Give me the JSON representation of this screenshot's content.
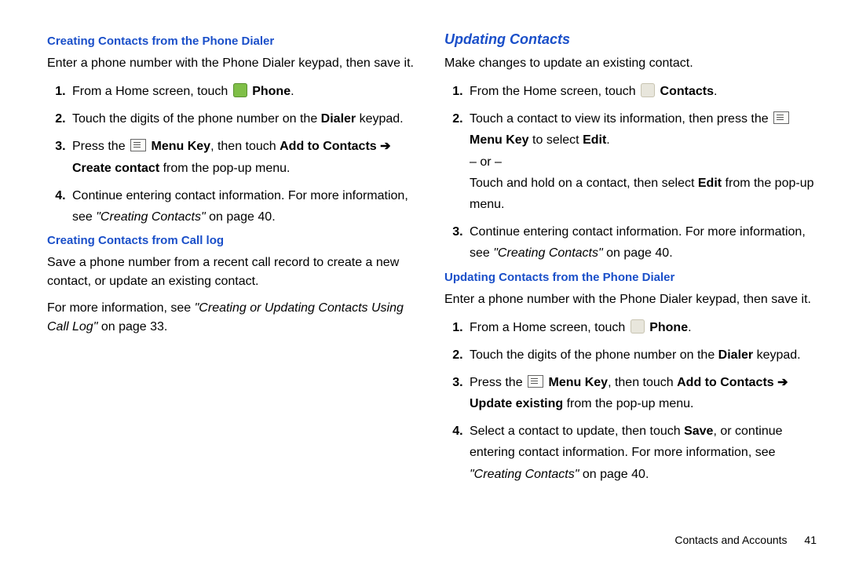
{
  "left": {
    "h1": "Creating Contacts from the Phone Dialer",
    "intro1": "Enter a phone number with the Phone Dialer keypad, then save it.",
    "s1_a": "From a Home screen, touch ",
    "s1_b": "Phone",
    "s1_c": ".",
    "s2_a": "Touch the digits of the phone number on the ",
    "s2_b": "Dialer",
    "s2_c": " keypad.",
    "s3_a": "Press the ",
    "s3_b": "Menu Key",
    "s3_c": ", then touch ",
    "s3_d": "Add to Contacts",
    "s3_e": " ➔ ",
    "s3_f": "Create contact",
    "s3_g": " from the pop-up menu.",
    "s4_a": "Continue entering contact information. For more information, see ",
    "s4_b": "\"Creating Contacts\"",
    "s4_c": " on page 40.",
    "h2": "Creating Contacts from Call log",
    "intro2": "Save a phone number from a recent call record to create a new contact, or update an existing contact.",
    "intro3_a": "For more information, see ",
    "intro3_b": "\"Creating or Updating Contacts Using Call Log\"",
    "intro3_c": " on page 33."
  },
  "right": {
    "sect": "Updating Contacts",
    "intro1": "Make changes to update an existing contact.",
    "s1_a": "From the Home screen, touch ",
    "s1_b": "Contacts",
    "s1_c": ".",
    "s2_a": "Touch a contact to view its information, then press the ",
    "s2_b": "Menu Key",
    "s2_c": " to select ",
    "s2_d": "Edit",
    "s2_e": ".",
    "s2_or": "– or –",
    "s2_f": "Touch and hold on a contact, then select ",
    "s2_g": "Edit",
    "s2_h": " from the pop-up menu.",
    "s3_a": "Continue entering contact information. For more information, see ",
    "s3_b": "\"Creating Contacts\"",
    "s3_c": " on page 40.",
    "h2": "Updating Contacts from the Phone Dialer",
    "intro2": "Enter a phone number with the Phone Dialer keypad, then save it.",
    "t1_a": "From a Home screen, touch ",
    "t1_b": "Phone",
    "t1_c": ".",
    "t2_a": "Touch the digits of the phone number on the ",
    "t2_b": "Dialer",
    "t2_c": " keypad.",
    "t3_a": "Press the ",
    "t3_b": "Menu Key",
    "t3_c": ", then touch ",
    "t3_d": "Add to Contacts",
    "t3_e": " ➔ ",
    "t3_f": "Update existing",
    "t3_g": " from the pop-up menu.",
    "t4_a": "Select a contact to update, then touch ",
    "t4_b": "Save",
    "t4_c": ", or continue entering contact information. For more information, see ",
    "t4_d": "\"Creating Contacts\"",
    "t4_e": " on page 40."
  },
  "footer": {
    "section": "Contacts and Accounts",
    "page": "41"
  }
}
